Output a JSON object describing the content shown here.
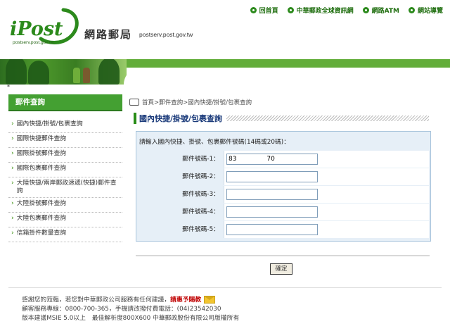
{
  "header": {
    "logo_text": "iPost",
    "logo_sub": "postserv.post.gov.tw",
    "site_name": "網路郵局",
    "site_url": "postserv.post.gov.tw",
    "nav": [
      "回首頁",
      "中華郵政全球資訊網",
      "網路ATM",
      "網站導覽"
    ]
  },
  "star": "*",
  "sidebar": {
    "title": "郵件查詢",
    "items": [
      "國內快捷/掛號/包裹查詢",
      "國際快捷郵件查詢",
      "國際掛號郵件查詢",
      "國際包裹郵件查詢",
      "大陸快捷/兩岸郵政速遞(快捷)郵件查詢",
      "大陸掛號郵件查詢",
      "大陸包裹郵件查詢",
      "信箱掛件數量查詢"
    ]
  },
  "breadcrumb": "首頁>郵件查詢>國內快捷/掛號/包裹查詢",
  "page_title": "國內快捷/掛號/包裹查詢",
  "form": {
    "instruction": "請輸入國內快捷、掛號、包裹郵件號碼(14碼或20碼)：",
    "rows": [
      {
        "label": "郵件號碼-1：",
        "value": "83               70"
      },
      {
        "label": "郵件號碼-2：",
        "value": ""
      },
      {
        "label": "郵件號碼-3：",
        "value": ""
      },
      {
        "label": "郵件號碼-4：",
        "value": ""
      },
      {
        "label": "郵件號碼-5：",
        "value": ""
      }
    ],
    "submit": "確定"
  },
  "footer": {
    "line1_pre": "感謝您的蒞臨，若您對中華郵政公司服務有任何建議，",
    "line1_link": "請惠予賜教",
    "line2": "顧客服務專線：0800-700-365，手機請改撥付費電話：(04)23542030",
    "line3": "版本建議MSIE 5.0以上　最佳解析度800X600 中華郵政股份有限公司版權所有"
  }
}
